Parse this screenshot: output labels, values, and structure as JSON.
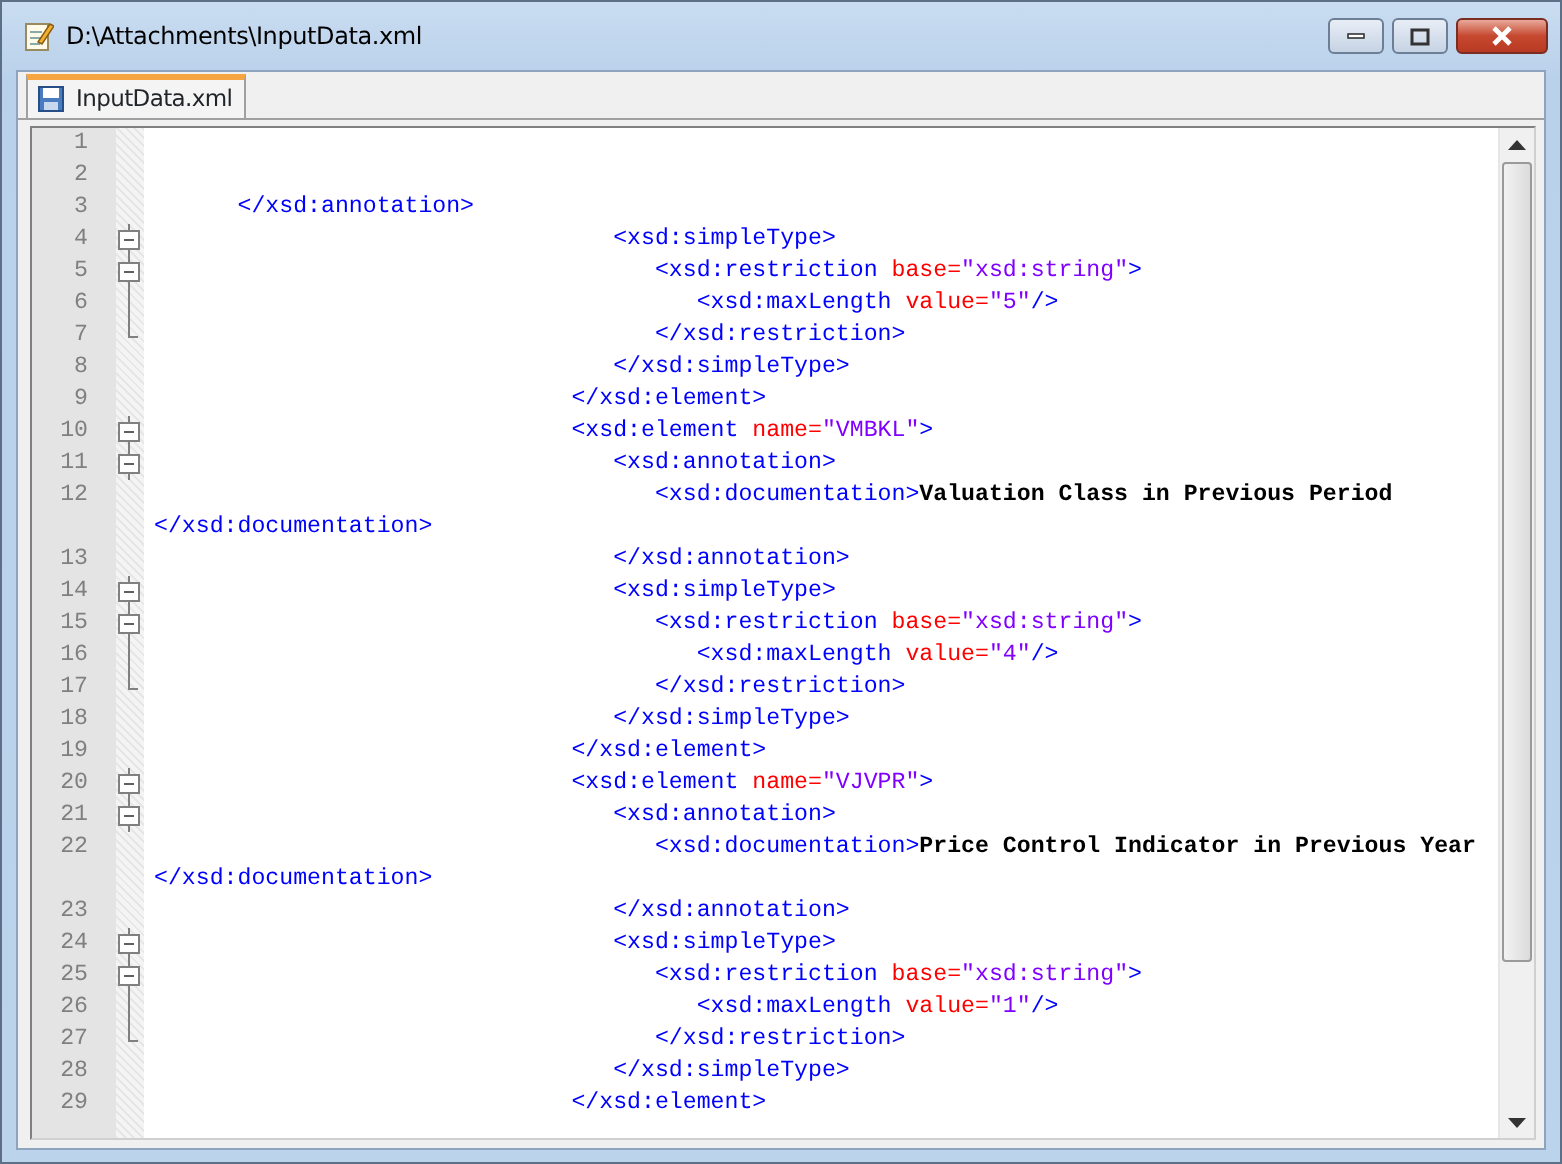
{
  "window": {
    "title": "D:\\Attachments\\InputData.xml"
  },
  "tabs": [
    {
      "label": "InputData.xml",
      "selected": true
    }
  ],
  "editor": {
    "lines": [
      {
        "number": "1"
      },
      {
        "number": "2"
      },
      {
        "number": "3",
        "tokens": [
          {
            "kind": "tag",
            "text": "      </xsd:annotation>"
          }
        ]
      },
      {
        "number": "4",
        "kind": "fold_start",
        "tokens": [
          {
            "kind": "tag",
            "text": "                                 <xsd:simpleType>"
          }
        ]
      },
      {
        "number": "5",
        "kind": "fold_start",
        "tokens": [
          {
            "kind": "tag",
            "text": "                                    <xsd:restriction "
          },
          {
            "kind": "attr",
            "text": "base="
          },
          {
            "kind": "value",
            "text": "\"xsd:string\""
          },
          {
            "kind": "tag",
            "text": ">"
          }
        ]
      },
      {
        "number": "6",
        "kind": "fold_body",
        "tokens": [
          {
            "kind": "tag",
            "text": "                                       <xsd:maxLength "
          },
          {
            "kind": "attr",
            "text": "value="
          },
          {
            "kind": "value",
            "text": "\"5\""
          },
          {
            "kind": "tag",
            "text": "/>"
          }
        ]
      },
      {
        "number": "7",
        "kind": "fold_end",
        "tokens": [
          {
            "kind": "tag",
            "text": "                                    </xsd:restriction>"
          }
        ]
      },
      {
        "number": "8",
        "tokens": [
          {
            "kind": "tag",
            "text": "                                 </xsd:simpleType>"
          }
        ]
      },
      {
        "number": "9",
        "tokens": [
          {
            "kind": "tag",
            "text": "                              </xsd:element>"
          }
        ]
      },
      {
        "number": "10",
        "kind": "fold_start",
        "tokens": [
          {
            "kind": "tag",
            "text": "                              <xsd:element "
          },
          {
            "kind": "attr",
            "text": "name="
          },
          {
            "kind": "value",
            "text": "\"VMBKL\""
          },
          {
            "kind": "tag",
            "text": ">"
          }
        ]
      },
      {
        "number": "11",
        "kind": "fold_start",
        "tokens": [
          {
            "kind": "tag",
            "text": "                                 <xsd:annotation>"
          }
        ]
      },
      {
        "number": "12",
        "tokens": [
          {
            "kind": "tag",
            "text": "                                    <xsd:documentation>"
          },
          {
            "kind": "text",
            "text": "Valuation Class in Previous Period"
          }
        ]
      },
      {
        "tokens": [
          {
            "kind": "tag",
            "text": "</xsd:documentation>"
          }
        ]
      },
      {
        "number": "13",
        "tokens": [
          {
            "kind": "tag",
            "text": "                                 </xsd:annotation>"
          }
        ]
      },
      {
        "number": "14",
        "kind": "fold_start",
        "tokens": [
          {
            "kind": "tag",
            "text": "                                 <xsd:simpleType>"
          }
        ]
      },
      {
        "number": "15",
        "kind": "fold_start",
        "tokens": [
          {
            "kind": "tag",
            "text": "                                    <xsd:restriction "
          },
          {
            "kind": "attr",
            "text": "base="
          },
          {
            "kind": "value",
            "text": "\"xsd:string\""
          },
          {
            "kind": "tag",
            "text": ">"
          }
        ]
      },
      {
        "number": "16",
        "kind": "fold_body",
        "tokens": [
          {
            "kind": "tag",
            "text": "                                       <xsd:maxLength "
          },
          {
            "kind": "attr",
            "text": "value="
          },
          {
            "kind": "value",
            "text": "\"4\""
          },
          {
            "kind": "tag",
            "text": "/>"
          }
        ]
      },
      {
        "number": "17",
        "kind": "fold_end",
        "tokens": [
          {
            "kind": "tag",
            "text": "                                    </xsd:restriction>"
          }
        ]
      },
      {
        "number": "18",
        "tokens": [
          {
            "kind": "tag",
            "text": "                                 </xsd:simpleType>"
          }
        ]
      },
      {
        "number": "19",
        "tokens": [
          {
            "kind": "tag",
            "text": "                              </xsd:element>"
          }
        ]
      },
      {
        "number": "20",
        "kind": "fold_start",
        "tokens": [
          {
            "kind": "tag",
            "text": "                              <xsd:element "
          },
          {
            "kind": "attr",
            "text": "name="
          },
          {
            "kind": "value",
            "text": "\"VJVPR\""
          },
          {
            "kind": "tag",
            "text": ">"
          }
        ]
      },
      {
        "number": "21",
        "kind": "fold_start",
        "tokens": [
          {
            "kind": "tag",
            "text": "                                 <xsd:annotation>"
          }
        ]
      },
      {
        "number": "22",
        "tokens": [
          {
            "kind": "tag",
            "text": "                                    <xsd:documentation>"
          },
          {
            "kind": "text",
            "text": "Price Control Indicator in Previous Year"
          }
        ]
      },
      {
        "tokens": [
          {
            "kind": "tag",
            "text": "</xsd:documentation>"
          }
        ]
      },
      {
        "number": "23",
        "tokens": [
          {
            "kind": "tag",
            "text": "                                 </xsd:annotation>"
          }
        ]
      },
      {
        "number": "24",
        "kind": "fold_start",
        "tokens": [
          {
            "kind": "tag",
            "text": "                                 <xsd:simpleType>"
          }
        ]
      },
      {
        "number": "25",
        "kind": "fold_start",
        "tokens": [
          {
            "kind": "tag",
            "text": "                                    <xsd:restriction "
          },
          {
            "kind": "attr",
            "text": "base="
          },
          {
            "kind": "value",
            "text": "\"xsd:string\""
          },
          {
            "kind": "tag",
            "text": ">"
          }
        ]
      },
      {
        "number": "26",
        "kind": "fold_body",
        "tokens": [
          {
            "kind": "tag",
            "text": "                                       <xsd:maxLength "
          },
          {
            "kind": "attr",
            "text": "value="
          },
          {
            "kind": "value",
            "text": "\"1\""
          },
          {
            "kind": "tag",
            "text": "/>"
          }
        ]
      },
      {
        "number": "27",
        "kind": "fold_end",
        "tokens": [
          {
            "kind": "tag",
            "text": "                                    </xsd:restriction>"
          }
        ]
      },
      {
        "number": "28",
        "tokens": [
          {
            "kind": "tag",
            "text": "                                 </xsd:simpleType>"
          }
        ]
      },
      {
        "number": "29",
        "tokens": [
          {
            "kind": "tag",
            "text": "                              </xsd:element>"
          }
        ]
      }
    ]
  }
}
